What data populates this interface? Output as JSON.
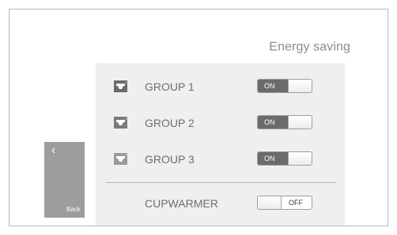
{
  "screen": {
    "title": "Energy saving"
  },
  "groups": [
    {
      "label": "GROUP 1",
      "toggle": "ON",
      "icon": "cup-dispenser-icon",
      "number": "1"
    },
    {
      "label": "GROUP 2",
      "toggle": "ON",
      "icon": "cup-dispenser-icon",
      "number": "2"
    },
    {
      "label": "GROUP 3",
      "toggle": "ON",
      "icon": "cup-dispenser-icon",
      "number": "3"
    }
  ],
  "cupwarmer": {
    "label": "CUPWARMER",
    "toggle": "OFF"
  },
  "back": {
    "label": "Back",
    "icon": "chevron-left-icon",
    "glyph": "‹"
  },
  "colors": {
    "on_fill": "#6b6b6b",
    "back_button": "#9d9d9d",
    "panel": "#efefef"
  }
}
